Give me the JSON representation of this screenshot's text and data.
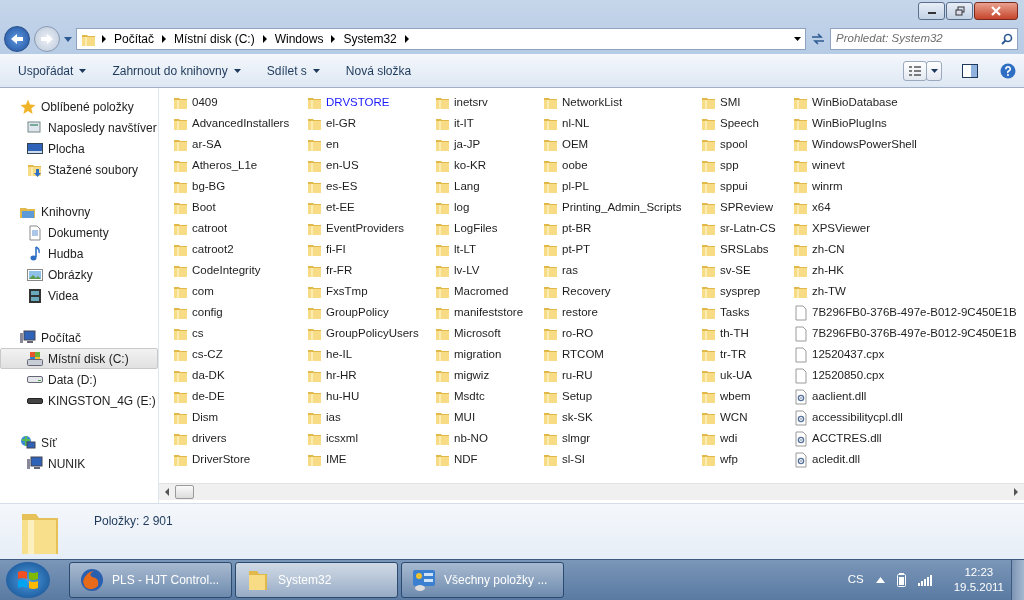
{
  "navigation": {
    "crumbs": [
      "Počítač",
      "Místní disk (C:)",
      "Windows",
      "System32"
    ],
    "search": {
      "placeholder": "Prohledat: System32"
    }
  },
  "toolbar": {
    "buttons": [
      {
        "label": "Uspořádat",
        "dropdown": true
      },
      {
        "label": "Zahrnout do knihovny",
        "dropdown": true
      },
      {
        "label": "Sdílet s",
        "dropdown": true
      },
      {
        "label": "Nová složka",
        "dropdown": false
      }
    ]
  },
  "sidebar": {
    "groups": [
      {
        "label": "Oblíbené položky",
        "kind": "favorites",
        "selected": false,
        "children": [
          {
            "label": "Naposledy navštíver",
            "kind": "recent",
            "selected": false
          },
          {
            "label": "Plocha",
            "kind": "desktop",
            "selected": false
          },
          {
            "label": "Stažené soubory",
            "kind": "downloads",
            "selected": false
          }
        ]
      },
      {
        "label": "Knihovny",
        "kind": "libraries",
        "selected": false,
        "children": [
          {
            "label": "Dokumenty",
            "kind": "documents",
            "selected": false
          },
          {
            "label": "Hudba",
            "kind": "music",
            "selected": false
          },
          {
            "label": "Obrázky",
            "kind": "pictures",
            "selected": false
          },
          {
            "label": "Videa",
            "kind": "videos",
            "selected": false
          }
        ]
      },
      {
        "label": "Počítač",
        "kind": "computer",
        "selected": false,
        "children": [
          {
            "label": "Místní disk (C:)",
            "kind": "system-drive",
            "selected": true
          },
          {
            "label": "Data (D:)",
            "kind": "drive",
            "selected": false
          },
          {
            "label": "KINGSTON_4G (E:)",
            "kind": "usb-drive",
            "selected": false
          }
        ]
      },
      {
        "label": "Síť",
        "kind": "network",
        "selected": false,
        "children": [
          {
            "label": "NUNIK",
            "kind": "computer",
            "selected": false
          }
        ]
      }
    ]
  },
  "files": {
    "columns": [
      [
        {
          "name": "0409",
          "kind": "folder",
          "compressed": false
        },
        {
          "name": "AdvancedInstallers",
          "kind": "folder",
          "compressed": false
        },
        {
          "name": "ar-SA",
          "kind": "folder",
          "compressed": false
        },
        {
          "name": "Atheros_L1e",
          "kind": "folder",
          "compressed": false
        },
        {
          "name": "bg-BG",
          "kind": "folder",
          "compressed": false
        },
        {
          "name": "Boot",
          "kind": "folder",
          "compressed": false
        },
        {
          "name": "catroot",
          "kind": "folder",
          "compressed": false
        },
        {
          "name": "catroot2",
          "kind": "folder",
          "compressed": false
        },
        {
          "name": "CodeIntegrity",
          "kind": "folder",
          "compressed": false
        },
        {
          "name": "com",
          "kind": "folder",
          "compressed": false
        },
        {
          "name": "config",
          "kind": "folder",
          "compressed": false
        },
        {
          "name": "cs",
          "kind": "folder",
          "compressed": false
        },
        {
          "name": "cs-CZ",
          "kind": "folder",
          "compressed": false
        },
        {
          "name": "da-DK",
          "kind": "folder",
          "compressed": false
        },
        {
          "name": "de-DE",
          "kind": "folder",
          "compressed": false
        },
        {
          "name": "Dism",
          "kind": "folder",
          "compressed": false
        },
        {
          "name": "drivers",
          "kind": "folder",
          "compressed": false
        },
        {
          "name": "DriverStore",
          "kind": "folder",
          "compressed": false
        }
      ],
      [
        {
          "name": "DRVSTORE",
          "kind": "folder",
          "compressed": true
        },
        {
          "name": "el-GR",
          "kind": "folder",
          "compressed": false
        },
        {
          "name": "en",
          "kind": "folder",
          "compressed": false
        },
        {
          "name": "en-US",
          "kind": "folder",
          "compressed": false
        },
        {
          "name": "es-ES",
          "kind": "folder",
          "compressed": false
        },
        {
          "name": "et-EE",
          "kind": "folder",
          "compressed": false
        },
        {
          "name": "EventProviders",
          "kind": "folder",
          "compressed": false
        },
        {
          "name": "fi-FI",
          "kind": "folder",
          "compressed": false
        },
        {
          "name": "fr-FR",
          "kind": "folder",
          "compressed": false
        },
        {
          "name": "FxsTmp",
          "kind": "folder",
          "compressed": false
        },
        {
          "name": "GroupPolicy",
          "kind": "folder",
          "compressed": false
        },
        {
          "name": "GroupPolicyUsers",
          "kind": "folder",
          "compressed": false
        },
        {
          "name": "he-IL",
          "kind": "folder",
          "compressed": false
        },
        {
          "name": "hr-HR",
          "kind": "folder",
          "compressed": false
        },
        {
          "name": "hu-HU",
          "kind": "folder",
          "compressed": false
        },
        {
          "name": "ias",
          "kind": "folder",
          "compressed": false
        },
        {
          "name": "icsxml",
          "kind": "folder",
          "compressed": false
        },
        {
          "name": "IME",
          "kind": "folder",
          "compressed": false
        }
      ],
      [
        {
          "name": "inetsrv",
          "kind": "folder",
          "compressed": false
        },
        {
          "name": "it-IT",
          "kind": "folder",
          "compressed": false
        },
        {
          "name": "ja-JP",
          "kind": "folder",
          "compressed": false
        },
        {
          "name": "ko-KR",
          "kind": "folder",
          "compressed": false
        },
        {
          "name": "Lang",
          "kind": "folder",
          "compressed": false
        },
        {
          "name": "log",
          "kind": "folder",
          "compressed": false
        },
        {
          "name": "LogFiles",
          "kind": "folder",
          "compressed": false
        },
        {
          "name": "lt-LT",
          "kind": "folder",
          "compressed": false
        },
        {
          "name": "lv-LV",
          "kind": "folder",
          "compressed": false
        },
        {
          "name": "Macromed",
          "kind": "folder",
          "compressed": false
        },
        {
          "name": "manifeststore",
          "kind": "folder",
          "compressed": false
        },
        {
          "name": "Microsoft",
          "kind": "folder",
          "compressed": false
        },
        {
          "name": "migration",
          "kind": "folder",
          "compressed": false
        },
        {
          "name": "migwiz",
          "kind": "folder",
          "compressed": false
        },
        {
          "name": "Msdtc",
          "kind": "folder",
          "compressed": false
        },
        {
          "name": "MUI",
          "kind": "folder",
          "compressed": false
        },
        {
          "name": "nb-NO",
          "kind": "folder",
          "compressed": false
        },
        {
          "name": "NDF",
          "kind": "folder",
          "compressed": false
        }
      ],
      [
        {
          "name": "NetworkList",
          "kind": "folder",
          "compressed": false
        },
        {
          "name": "nl-NL",
          "kind": "folder",
          "compressed": false
        },
        {
          "name": "OEM",
          "kind": "folder",
          "compressed": false
        },
        {
          "name": "oobe",
          "kind": "folder",
          "compressed": false
        },
        {
          "name": "pl-PL",
          "kind": "folder",
          "compressed": false
        },
        {
          "name": "Printing_Admin_Scripts",
          "kind": "folder",
          "compressed": false
        },
        {
          "name": "pt-BR",
          "kind": "folder",
          "compressed": false
        },
        {
          "name": "pt-PT",
          "kind": "folder",
          "compressed": false
        },
        {
          "name": "ras",
          "kind": "folder",
          "compressed": false
        },
        {
          "name": "Recovery",
          "kind": "folder",
          "compressed": false
        },
        {
          "name": "restore",
          "kind": "folder",
          "compressed": false
        },
        {
          "name": "ro-RO",
          "kind": "folder",
          "compressed": false
        },
        {
          "name": "RTCOM",
          "kind": "folder",
          "compressed": false
        },
        {
          "name": "ru-RU",
          "kind": "folder",
          "compressed": false
        },
        {
          "name": "Setup",
          "kind": "folder",
          "compressed": false
        },
        {
          "name": "sk-SK",
          "kind": "folder",
          "compressed": false
        },
        {
          "name": "slmgr",
          "kind": "folder",
          "compressed": false
        },
        {
          "name": "sl-SI",
          "kind": "folder",
          "compressed": false
        }
      ],
      [
        {
          "name": "SMI",
          "kind": "folder",
          "compressed": false
        },
        {
          "name": "Speech",
          "kind": "folder",
          "compressed": false
        },
        {
          "name": "spool",
          "kind": "folder",
          "compressed": false
        },
        {
          "name": "spp",
          "kind": "folder",
          "compressed": false
        },
        {
          "name": "sppui",
          "kind": "folder",
          "compressed": false
        },
        {
          "name": "SPReview",
          "kind": "folder",
          "compressed": false
        },
        {
          "name": "sr-Latn-CS",
          "kind": "folder",
          "compressed": false
        },
        {
          "name": "SRSLabs",
          "kind": "folder",
          "compressed": false
        },
        {
          "name": "sv-SE",
          "kind": "folder",
          "compressed": false
        },
        {
          "name": "sysprep",
          "kind": "folder",
          "compressed": false
        },
        {
          "name": "Tasks",
          "kind": "folder",
          "compressed": false
        },
        {
          "name": "th-TH",
          "kind": "folder",
          "compressed": false
        },
        {
          "name": "tr-TR",
          "kind": "folder",
          "compressed": false
        },
        {
          "name": "uk-UA",
          "kind": "folder",
          "compressed": false
        },
        {
          "name": "wbem",
          "kind": "folder",
          "compressed": false
        },
        {
          "name": "WCN",
          "kind": "folder",
          "compressed": false
        },
        {
          "name": "wdi",
          "kind": "folder",
          "compressed": false
        },
        {
          "name": "wfp",
          "kind": "folder",
          "compressed": false
        }
      ],
      [
        {
          "name": "WinBioDatabase",
          "kind": "folder",
          "compressed": false
        },
        {
          "name": "WinBioPlugIns",
          "kind": "folder",
          "compressed": false
        },
        {
          "name": "WindowsPowerShell",
          "kind": "folder",
          "compressed": false
        },
        {
          "name": "winevt",
          "kind": "folder",
          "compressed": false
        },
        {
          "name": "winrm",
          "kind": "folder",
          "compressed": false
        },
        {
          "name": "x64",
          "kind": "folder",
          "compressed": false
        },
        {
          "name": "XPSViewer",
          "kind": "folder",
          "compressed": false
        },
        {
          "name": "zh-CN",
          "kind": "folder",
          "compressed": false
        },
        {
          "name": "zh-HK",
          "kind": "folder",
          "compressed": false
        },
        {
          "name": "zh-TW",
          "kind": "folder",
          "compressed": false
        },
        {
          "name": "7B296FB0-376B-497e-B012-9C450E1B",
          "kind": "file",
          "compressed": false
        },
        {
          "name": "7B296FB0-376B-497e-B012-9C450E1B",
          "kind": "file",
          "compressed": false
        },
        {
          "name": "12520437.cpx",
          "kind": "file",
          "compressed": false
        },
        {
          "name": "12520850.cpx",
          "kind": "file",
          "compressed": false
        },
        {
          "name": "aaclient.dll",
          "kind": "dll",
          "compressed": false
        },
        {
          "name": "accessibilitycpl.dll",
          "kind": "dll",
          "compressed": false
        },
        {
          "name": "ACCTRES.dll",
          "kind": "dll",
          "compressed": false
        },
        {
          "name": "acledit.dll",
          "kind": "dll",
          "compressed": false
        }
      ]
    ]
  },
  "details": {
    "text": "Položky: 2 901"
  },
  "taskbar": {
    "buttons": [
      {
        "label": "PLS - HJT Control...",
        "kind": "browser",
        "active": false
      },
      {
        "label": "System32",
        "kind": "folder",
        "active": true
      },
      {
        "label": "Všechny položky ...",
        "kind": "control-panel",
        "active": false
      }
    ],
    "tray": {
      "language": "CS",
      "time": "12:23",
      "date": "19.5.2011"
    }
  }
}
